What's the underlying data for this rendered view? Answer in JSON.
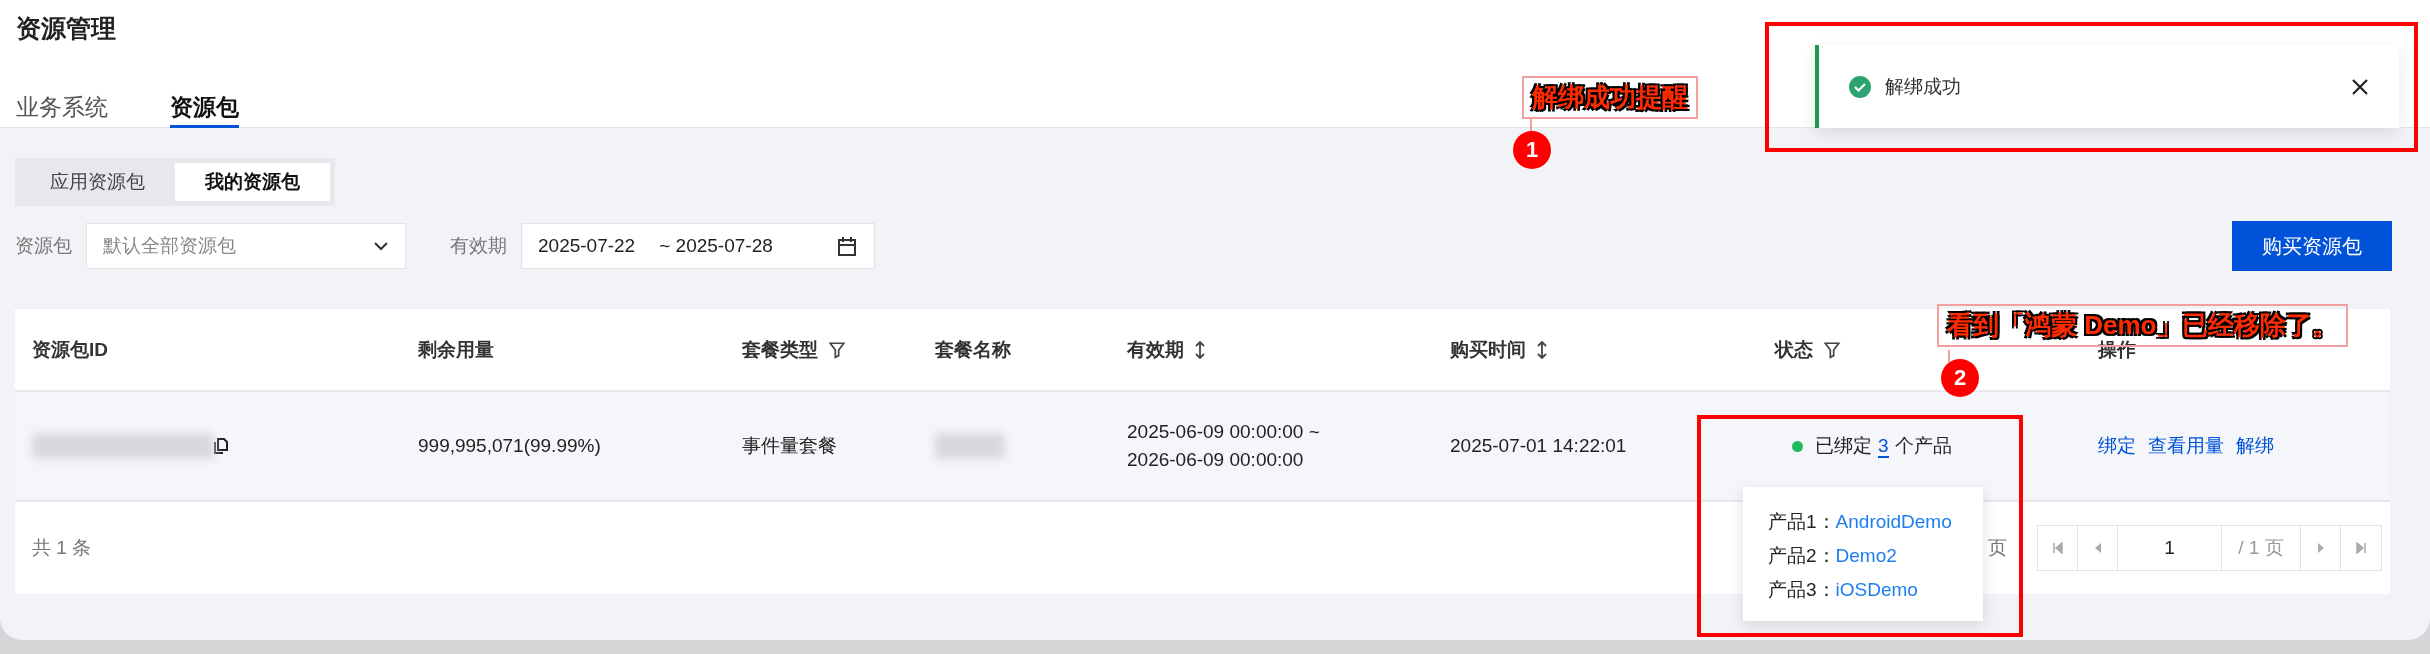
{
  "page_title": "资源管理",
  "tabs": [
    {
      "label": "业务系统",
      "selected": false
    },
    {
      "label": "资源包",
      "selected": true
    }
  ],
  "segments": [
    {
      "label": "应用资源包",
      "selected": false
    },
    {
      "label": "我的资源包",
      "selected": true
    }
  ],
  "filters": {
    "package_label": "资源包",
    "package_placeholder": "默认全部资源包",
    "validity_label": "有效期",
    "date_start": "2025-07-22",
    "date_end": "~ 2025-07-28"
  },
  "buy_button": "购买资源包",
  "table": {
    "columns": [
      {
        "label": "资源包ID",
        "kind": "plain"
      },
      {
        "label": "剩余用量",
        "kind": "plain"
      },
      {
        "label": "套餐类型",
        "kind": "filter"
      },
      {
        "label": "套餐名称",
        "kind": "plain"
      },
      {
        "label": "有效期",
        "kind": "sort"
      },
      {
        "label": "购买时间",
        "kind": "sort"
      },
      {
        "label": "状态",
        "kind": "filter"
      },
      {
        "label": "操作",
        "kind": "plain"
      }
    ],
    "rows": [
      {
        "remaining": "999,995,071(99.99%)",
        "type": "事件量套餐",
        "validity": [
          "2025-06-09 00:00:00 ~",
          "2026-06-09 00:00:00"
        ],
        "purchase_time": "2025-07-01 14:22:01",
        "status": {
          "color": "#1fba5e",
          "prefix": "已绑定",
          "count": "3",
          "suffix": "个产品"
        },
        "actions": [
          "绑定",
          "查看用量",
          "解绑"
        ]
      }
    ],
    "footer": {
      "total": "共 1 条",
      "pages_fragment": "页",
      "page": "1",
      "page_total": "/ 1 页"
    }
  },
  "popover": {
    "items": [
      {
        "label": "产品1：",
        "value": "AndroidDemo"
      },
      {
        "label": "产品2：",
        "value": "Demo2"
      },
      {
        "label": "产品3：",
        "value": "iOSDemo"
      }
    ]
  },
  "toast": {
    "message": "解绑成功"
  },
  "annotations": [
    {
      "number": "1",
      "text": "解绑成功提醒"
    },
    {
      "number": "2",
      "text": "看到「鸿蒙 Demo」已经移除了。"
    }
  ]
}
